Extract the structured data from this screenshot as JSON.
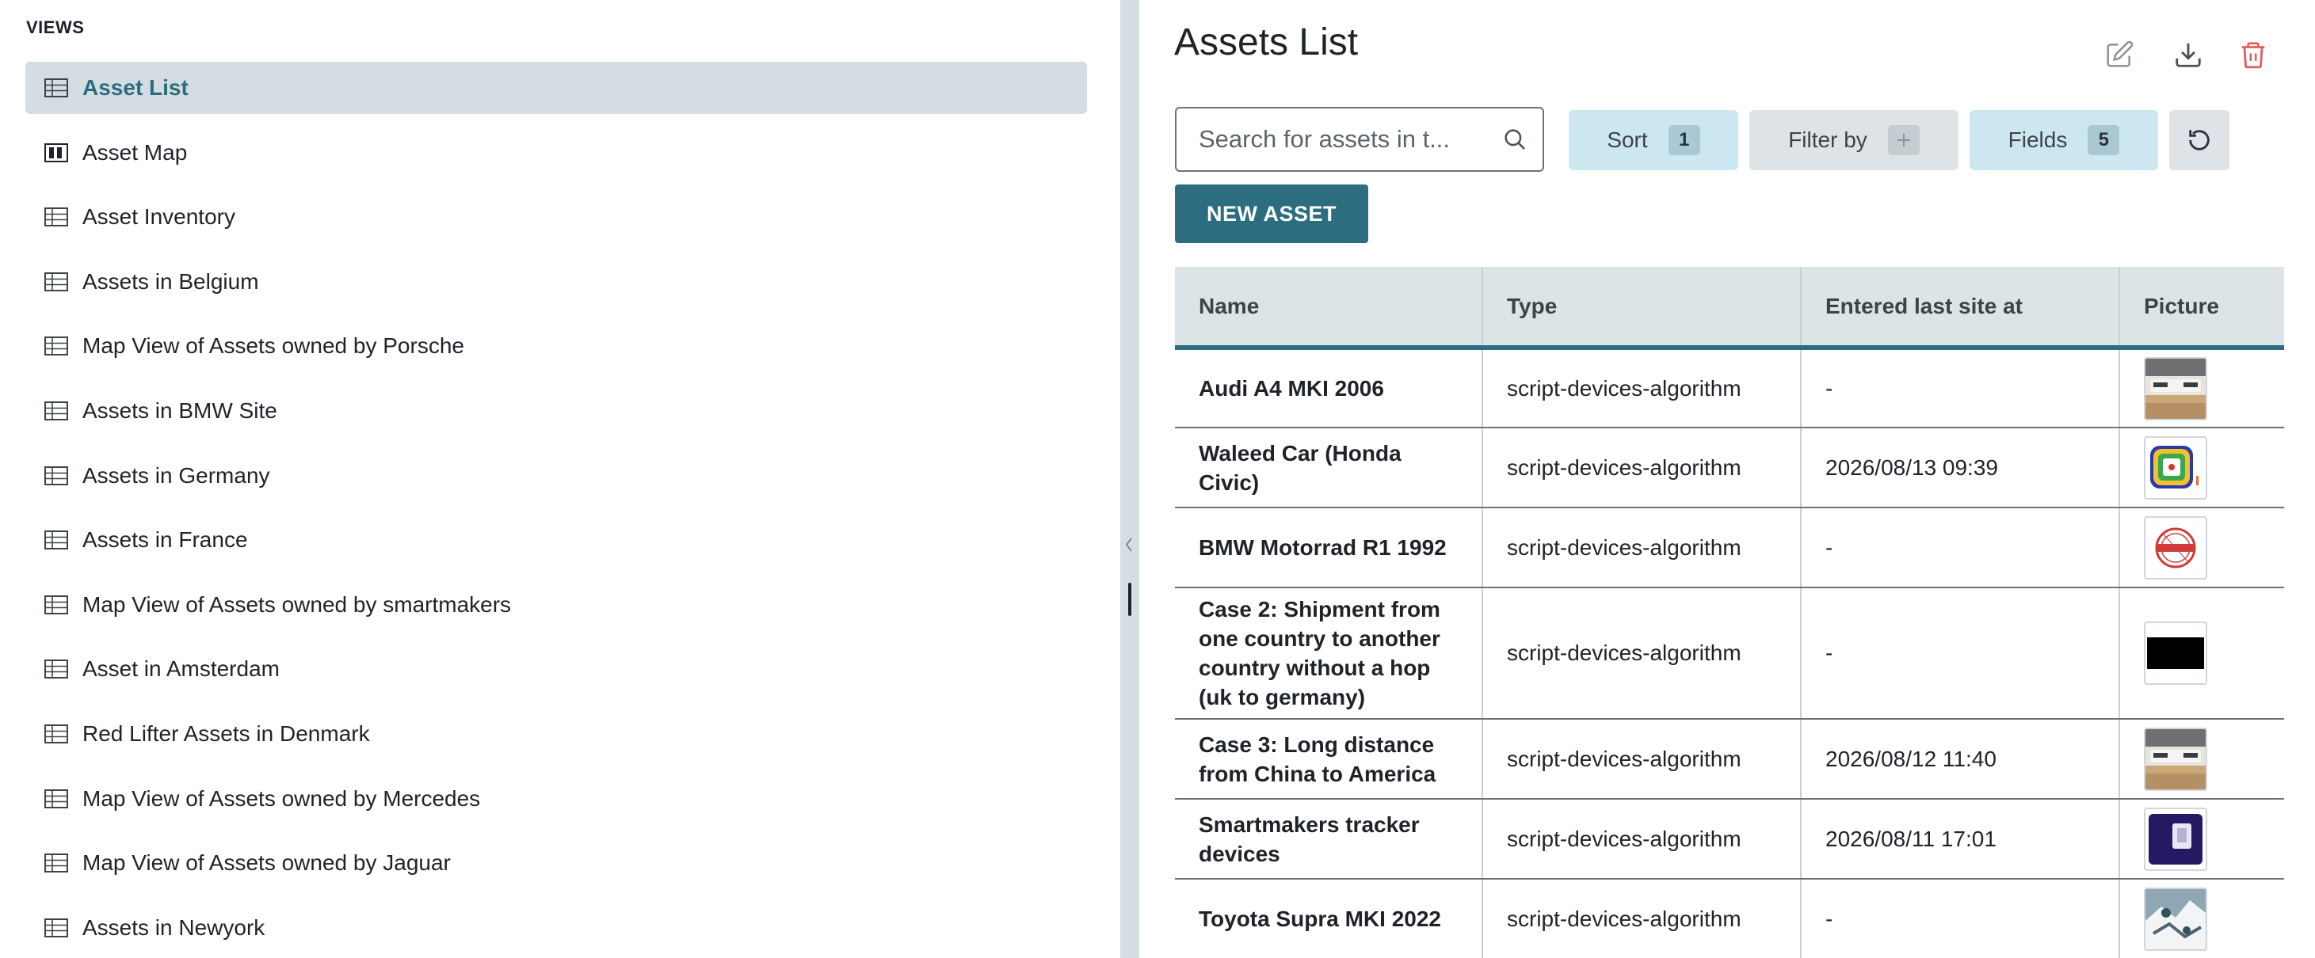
{
  "sidebar": {
    "heading": "VIEWS",
    "items": [
      {
        "label": "Asset List",
        "icon": "table-icon",
        "active": true
      },
      {
        "label": "Asset Map",
        "icon": "map-columns-icon"
      },
      {
        "label": "Asset Inventory",
        "icon": "table-icon"
      },
      {
        "label": "Assets in Belgium",
        "icon": "table-icon"
      },
      {
        "label": "Map View of Assets owned by Porsche",
        "icon": "table-icon"
      },
      {
        "label": "Assets in BMW Site",
        "icon": "table-icon"
      },
      {
        "label": "Assets in Germany",
        "icon": "table-icon"
      },
      {
        "label": "Assets in France",
        "icon": "table-icon"
      },
      {
        "label": "Map View of Assets owned by smartmakers",
        "icon": "table-icon"
      },
      {
        "label": "Asset in Amsterdam",
        "icon": "table-icon"
      },
      {
        "label": "Red Lifter Assets in Denmark",
        "icon": "table-icon"
      },
      {
        "label": "Map View of Assets owned by Mercedes",
        "icon": "table-icon"
      },
      {
        "label": "Map View of Assets owned by Jaguar",
        "icon": "table-icon"
      },
      {
        "label": "Assets in Newyork",
        "icon": "table-icon"
      }
    ]
  },
  "header": {
    "title": "Assets List",
    "actions": [
      "edit-icon",
      "download-icon",
      "delete-icon"
    ]
  },
  "toolbar": {
    "search_placeholder": "Search for assets in t...",
    "sort_label": "Sort",
    "sort_count": "1",
    "filter_label": "Filter by",
    "fields_label": "Fields",
    "fields_count": "5",
    "new_asset_label": "NEW ASSET"
  },
  "table": {
    "columns": [
      "Name",
      "Type",
      "Entered last site at",
      "Picture"
    ],
    "rows": [
      {
        "name": "Audi A4 MKI 2006",
        "type": "script-devices-algorithm",
        "entered": "-",
        "picture": "car-photo-thumbnail"
      },
      {
        "name": "Waleed Car (Honda Civic)",
        "type": "script-devices-algorithm",
        "entered": "2026/08/13 09:39",
        "picture": "colorful-badge-thumbnail"
      },
      {
        "name": "BMW Motorrad R1 1992",
        "type": "script-devices-algorithm",
        "entered": "-",
        "picture": "sample-stamp-thumbnail"
      },
      {
        "name": "Case 2: Shipment from one country to another country without a hop (uk to germany)",
        "type": "script-devices-algorithm",
        "entered": "-",
        "picture": "black-thumbnail"
      },
      {
        "name": "Case 3: Long distance from China to America",
        "type": "script-devices-algorithm",
        "entered": "2026/08/12 11:40",
        "picture": "car-photo-thumbnail"
      },
      {
        "name": "Smartmakers tracker devices",
        "type": "script-devices-algorithm",
        "entered": "2026/08/11 17:01",
        "picture": "tracker-device-thumbnail"
      },
      {
        "name": "Toyota Supra MKI 2022",
        "type": "script-devices-algorithm",
        "entered": "-",
        "picture": "snow-photo-thumbnail"
      }
    ]
  },
  "colors": {
    "accent": "#2c6e80",
    "active_item_bg": "#d4dde2",
    "chip_blue": "#cde7f0",
    "chip_grey": "#dde3e6",
    "delete_red": "#e06060"
  }
}
